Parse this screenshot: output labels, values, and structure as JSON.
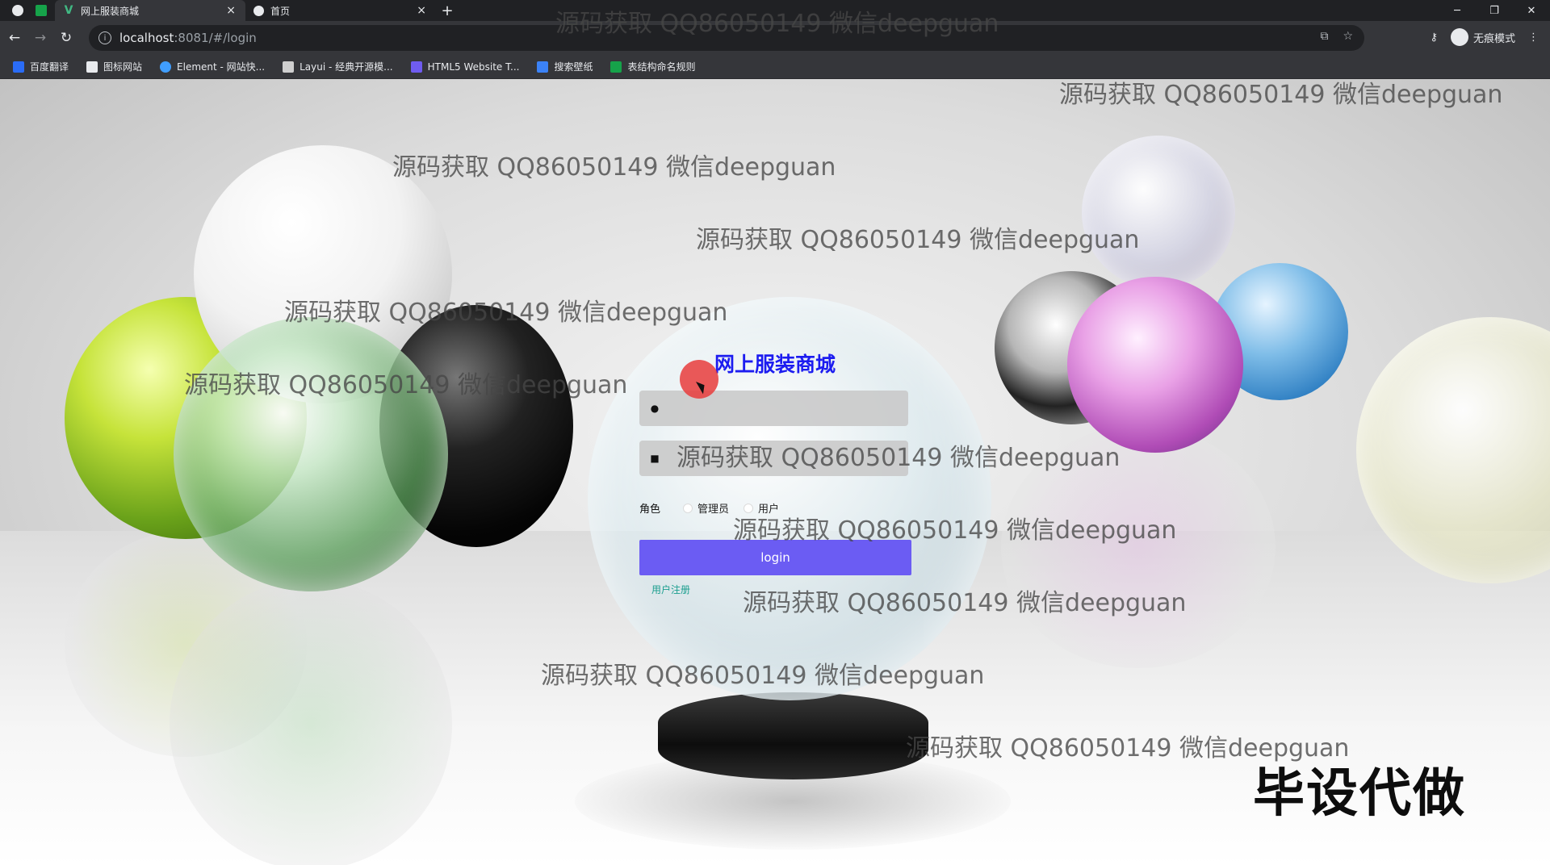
{
  "browser": {
    "tabs": [
      {
        "title": "网上服装商城",
        "active": true
      },
      {
        "title": "首页",
        "active": false
      }
    ],
    "new_tab": "+",
    "window_controls": {
      "minimize": "─",
      "maximize": "❐",
      "close": "✕"
    },
    "url_host": "localhost",
    "url_rest": ":8081/#/login",
    "incognito_label": "无痕模式",
    "bookmarks": [
      {
        "label": "百度翻译",
        "color": "#2a6cf6"
      },
      {
        "label": "图标网站",
        "color": "#e8eaed"
      },
      {
        "label": "Element - 网站快...",
        "color": "#409eff"
      },
      {
        "label": "Layui - 经典开源模...",
        "color": "#cfcfcf"
      },
      {
        "label": "HTML5 Website T...",
        "color": "#6f5cf0"
      },
      {
        "label": "搜索壁纸",
        "color": "#3b82f6"
      },
      {
        "label": "表结构命名规则",
        "color": "#16a34a"
      }
    ]
  },
  "login": {
    "title": "网上服装商城",
    "username_value": "",
    "password_value": "",
    "role_label": "角色",
    "roles": [
      "管理员",
      "用户"
    ],
    "button_label": "login",
    "register_link": "用户注册"
  },
  "watermark_text": "源码获取 QQ86050149 微信deepguan",
  "badge_text": "毕设代做",
  "colors": {
    "title": "#1c1cf0",
    "button": "#6b5cf3",
    "link": "#1a9e8e"
  }
}
